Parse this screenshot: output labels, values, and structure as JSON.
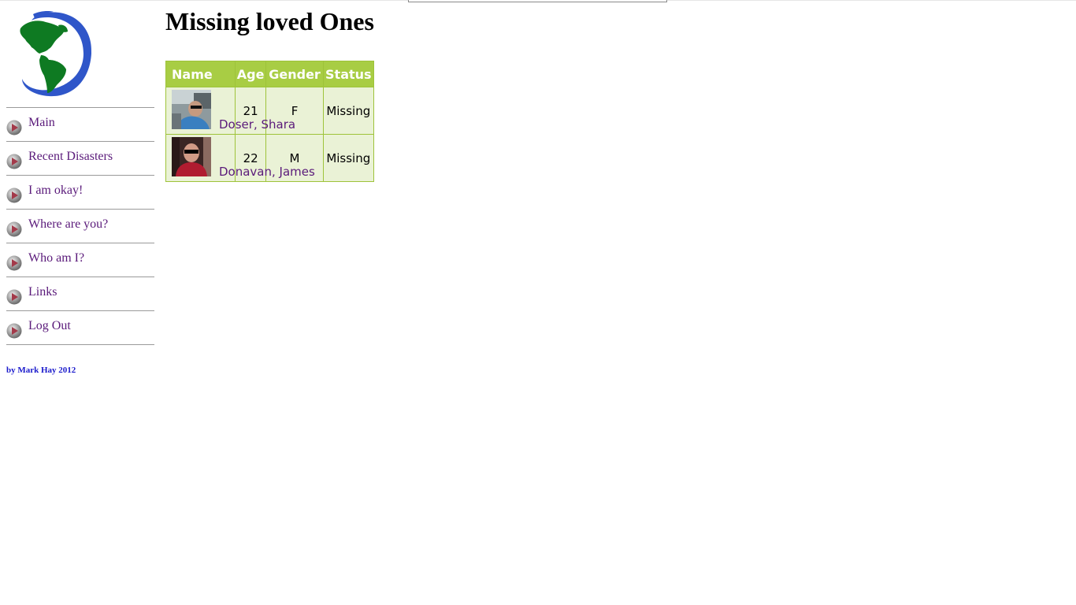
{
  "page": {
    "title": "Missing loved Ones"
  },
  "sidebar": {
    "items": [
      {
        "label": "Main"
      },
      {
        "label": "Recent Disasters"
      },
      {
        "label": "I am okay!"
      },
      {
        "label": "Where are you?"
      },
      {
        "label": "Who am I?"
      },
      {
        "label": "Links"
      },
      {
        "label": "Log Out"
      }
    ],
    "credit": "by Mark Hay 2012"
  },
  "table": {
    "headers": {
      "name": "Name",
      "age": "Age",
      "gender": "Gender",
      "status": "Status"
    },
    "rows": [
      {
        "name": "Doser, Shara",
        "age": "21",
        "gender": "F",
        "status": "Missing"
      },
      {
        "name": "Donavan, James",
        "age": "22",
        "gender": "M",
        "status": "Missing"
      }
    ]
  },
  "colors": {
    "header_bg": "#a8cd44",
    "row_bg": "#eaf2d6",
    "link": "#5a1a7a",
    "credit": "#1a1acc"
  },
  "icons": {
    "logo": "globe-americas-icon",
    "nav_bullet": "play-bullet-icon"
  }
}
